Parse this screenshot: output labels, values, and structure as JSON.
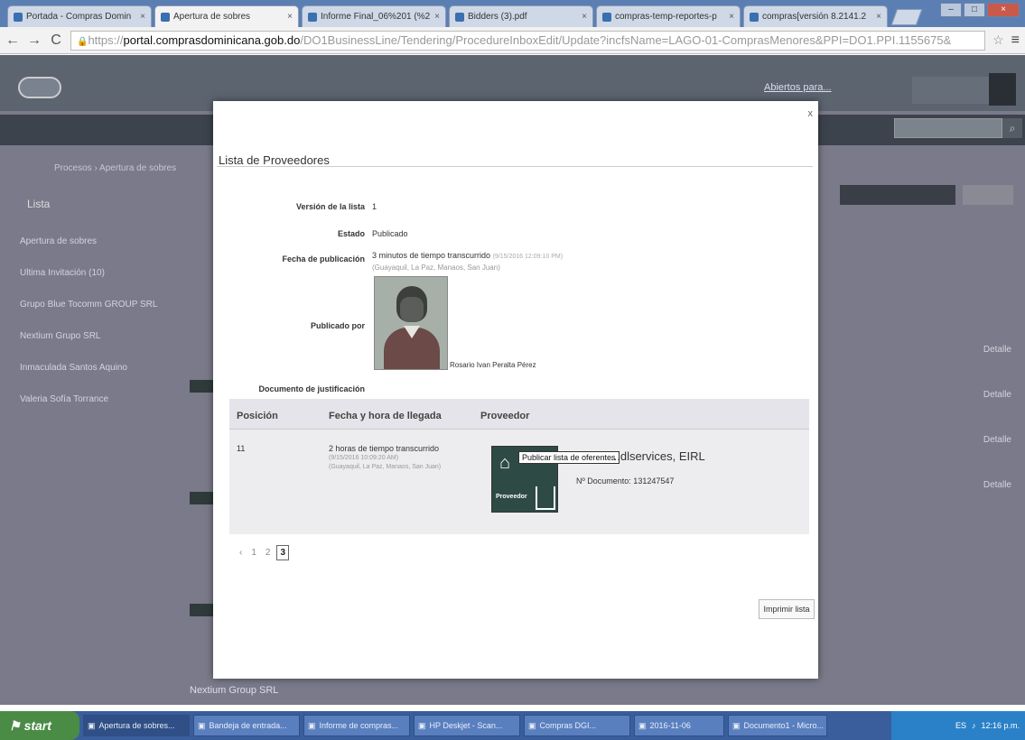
{
  "browser": {
    "tabs": [
      {
        "label": "Portada - Compras Domin",
        "active": false
      },
      {
        "label": "Apertura de sobres",
        "active": true
      },
      {
        "label": "Informe Final_06%201 (%2",
        "active": false
      },
      {
        "label": "Bidders (3).pdf",
        "active": false
      },
      {
        "label": "compras-temp-reportes-p",
        "active": false
      },
      {
        "label": "compras[versión 8.2141.2",
        "active": false
      }
    ],
    "close_glyph": "×",
    "url_scheme": "https://",
    "url_domain": "portal.comprasdominicana.gob.do",
    "url_path": "/DO1BusinessLine/Tendering/ProcedureInboxEdit/Update?incfsName=LAGO-01-ComprasMenores&PPI=DO1.PPI.1155675&",
    "back": "←",
    "forward": "→",
    "reload": "C",
    "lock": "🔒",
    "star": "☆",
    "menu": "≡",
    "win_minimize": "–",
    "win_maximize": "□",
    "win_close": "×"
  },
  "site": {
    "header_link": "Abiertos para...",
    "breadcrumb": "Procesos  ›  Apertura de sobres",
    "bg_title": "Lista",
    "bg_left_items": [
      "Apertura de sobres",
      "Ultima Invitación (10)",
      "Grupo Blue Tocomm GROUP SRL",
      "Nextium Grupo SRL",
      "Inmaculada Santos Aquino",
      "Valeria Sofía Torrance"
    ],
    "bg_right_items": [
      "Detalle",
      "Detalle",
      "Detalle",
      "Detalle"
    ],
    "bg_bottom": "Nextium Group SRL"
  },
  "modal": {
    "close_label": "x",
    "title": "Lista de Proveedores",
    "fields": {
      "version_label": "Versión de la lista",
      "version_value": "1",
      "estado_label": "Estado",
      "estado_value": "Publicado",
      "fecha_label": "Fecha de publicación",
      "fecha_value": "3 minutos de tiempo transcurrido",
      "fecha_meta": "(9/15/2016 12:09:10 PM)",
      "fecha_zone": "(Guayaquil, La Paz, Manaos, San Juan)",
      "publicado_label": "Publicado por",
      "publicado_value": "Rosario Ivan Peralta Pérez",
      "justificacion_label": "Documento de justificación"
    },
    "table": {
      "headers": [
        "Posición",
        "Fecha y hora de llegada",
        "Proveedor"
      ],
      "rows": [
        {
          "posicion": "11",
          "fecha": "2 horas de tiempo transcurrido",
          "fecha_meta": "(9/15/2016 10:09:20 AM)",
          "fecha_zone": "(Guayaquil, La Paz, Manaos, San Juan)",
          "proveedor_name": "...dlservices, EIRL",
          "proveedor_doc": "Nº Documento: 131247547",
          "tooltip": "Publicar lista de oferentes",
          "badge_label": "Proveedor"
        }
      ]
    },
    "pagination": {
      "prev": "‹",
      "pages": [
        "1",
        "2",
        "3"
      ],
      "current": "3"
    },
    "print_label": "Imprimir lista"
  },
  "taskbar": {
    "start_label": "start",
    "tasks": [
      {
        "label": "Apertura de sobres...",
        "active": true
      },
      {
        "label": "Bandeja de entrada...",
        "active": false
      },
      {
        "label": "Informe de compras...",
        "active": false
      },
      {
        "label": "HP Deskjet - Scan...",
        "active": false
      },
      {
        "label": "Compras DGI...",
        "active": false
      },
      {
        "label": "2016-11-06",
        "active": false
      },
      {
        "label": "Documento1 - Micro...",
        "active": false
      }
    ],
    "lang": "ES",
    "clock": "12:16 p.m."
  },
  "colors": {
    "dim_overlay": "#7a7a8a",
    "tab_bar": "#5b7fb3",
    "taskbar": "#3a5e9c",
    "start_green": "#4a8b46"
  }
}
